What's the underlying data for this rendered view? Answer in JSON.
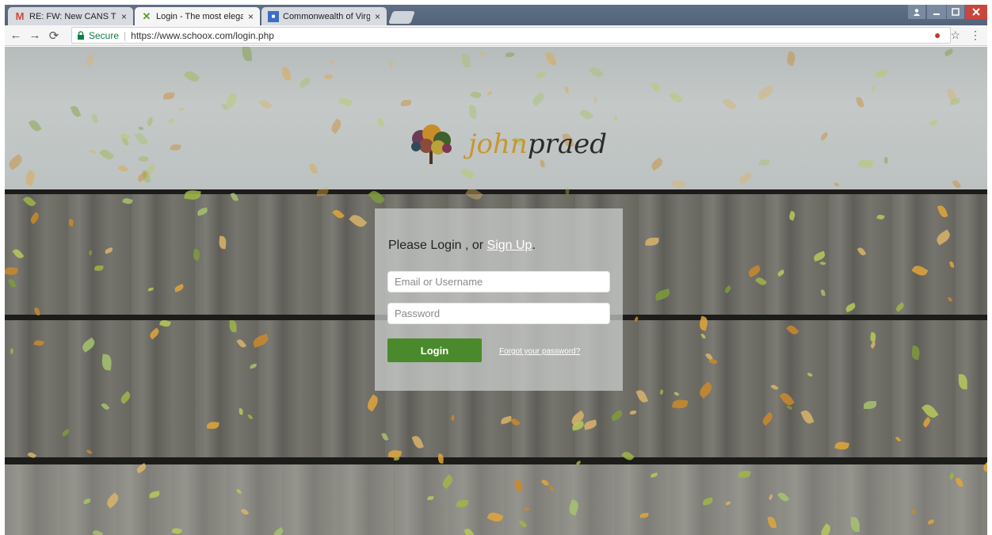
{
  "browser": {
    "tabs": [
      {
        "title": "RE: FW: New CANS Train",
        "close": "×",
        "favicon": "M",
        "favicon_name": "gmail-icon",
        "color": "#d44638"
      },
      {
        "title": "Login - The most elegant",
        "close": "×",
        "favicon": "✕",
        "favicon_name": "schoox-icon",
        "color": "#5aa02c"
      },
      {
        "title": "Commonwealth of Virgin",
        "close": "×",
        "favicon": "■",
        "favicon_name": "site-icon",
        "color": "#3b6cc7"
      }
    ],
    "secure_label": "Secure",
    "url": "https://www.schoox.com/login.php",
    "separator": "|"
  },
  "logo": {
    "text_accent": "john",
    "text_main": "praed"
  },
  "login": {
    "heading_prefix": "Please Login , or ",
    "signup_link": "Sign Up",
    "heading_suffix": ".",
    "email_placeholder": "Email or Username",
    "password_placeholder": "Password",
    "login_button": "Login",
    "forgot_link": "Forgot your password?"
  },
  "colors": {
    "login_button": "#4b8a2c",
    "link": "#ffffff"
  }
}
